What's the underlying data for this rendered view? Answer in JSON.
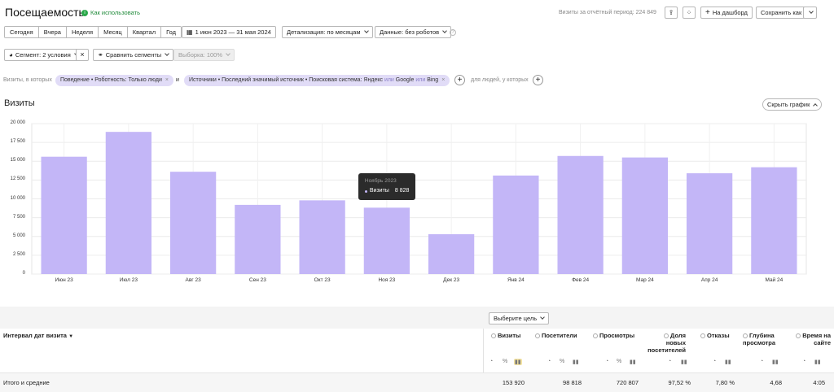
{
  "header": {
    "title": "Посещаемость",
    "help_link": "Как использовать",
    "period_visits": "Визиты за отчётный период: 224 849",
    "dashboard_button": "На дашборд",
    "save_button": "Сохранить как"
  },
  "toolbar": {
    "periods": [
      "Сегодня",
      "Вчера",
      "Неделя",
      "Месяц",
      "Квартал",
      "Год"
    ],
    "date_range": "1 июн 2023 — 31 мая 2024",
    "detail": "Детализация: по месяцам",
    "data_filter": "Данные: без роботов"
  },
  "segments": {
    "segment": "Сегмент: 2 условия",
    "compare": "Сравнить сегменты",
    "sample": "Выборка: 100%"
  },
  "filters": {
    "visits_prefix": "Визиты, в которых",
    "chip1": "Поведение • Роботность: Только люди",
    "and": "и",
    "chip2_a": "Источники • Последний значимый источник • Поисковая система: Яндекс",
    "chip2_or1": "или",
    "chip2_b": "Google",
    "chip2_or2": "или",
    "chip2_c": "Bing",
    "people_suffix": "для людей, у которых"
  },
  "chart_section": {
    "title": "Визиты",
    "hide_button": "Скрыть график"
  },
  "chart_data": {
    "type": "bar",
    "categories": [
      "Июн 23",
      "Июл 23",
      "Авг 23",
      "Сен 23",
      "Окт 23",
      "Ноя 23",
      "Дек 23",
      "Янв 24",
      "Фев 24",
      "Мар 24",
      "Апр 24",
      "Май 24"
    ],
    "series": [
      {
        "name": "Визиты",
        "values": [
          15600,
          18900,
          13600,
          9200,
          9800,
          8828,
          5300,
          13100,
          15700,
          15500,
          13400,
          14200
        ]
      }
    ],
    "yticks": [
      "20 000",
      "17 500",
      "15 000",
      "12 500",
      "10 000",
      "7 500",
      "5 000",
      "2 500",
      "0"
    ],
    "ylim": [
      0,
      20000
    ],
    "bar_color": "#c3b6f7",
    "grid": true,
    "tooltip": {
      "period": "Ноябрь 2023",
      "label": "Визиты",
      "value": "8 828",
      "index": 5
    }
  },
  "table": {
    "goal_button": "Выберите цель",
    "group_header": "Интервал дат визита",
    "columns": [
      {
        "name": "Визиты",
        "total": "153 920"
      },
      {
        "name": "Посетители",
        "total": "98 818"
      },
      {
        "name": "Просмотры",
        "total": "720 807"
      },
      {
        "name": "Доля новых посетителей",
        "total": "97,52 %"
      },
      {
        "name": "Отказы",
        "total": "7,80 %"
      },
      {
        "name": "Глубина просмотра",
        "total": "4,68"
      },
      {
        "name": "Время на сайте",
        "total": "4:05"
      }
    ],
    "totals_label": "Итого и средние"
  }
}
